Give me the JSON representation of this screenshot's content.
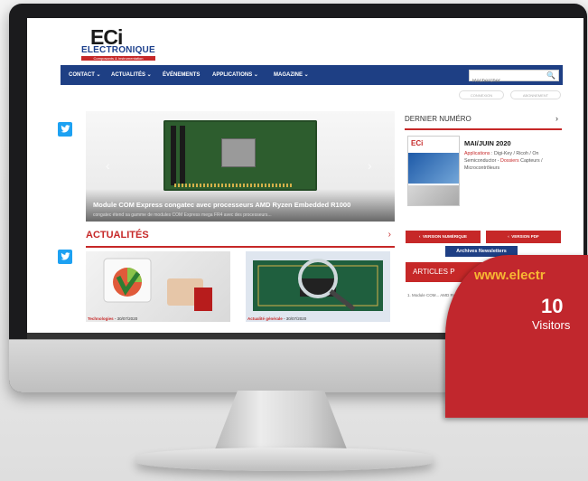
{
  "site": {
    "logo_main": "ECi",
    "logo_sub": "ELECTRONIQUE",
    "logo_tagline": "Composants & Instrumentation"
  },
  "nav": {
    "items": [
      "CONTACT ⌄",
      "ACTUALITÉS ⌄",
      "ÉVÉNEMENTS",
      "APPLICATIONS ⌄",
      "MAGAZINE ⌄"
    ],
    "search_placeholder": "Rechercher",
    "connexion": "CONNEXION",
    "abonnement": "ABONNEMENT"
  },
  "hero": {
    "title": "Module COM Express congatec avec processeurs AMD Ryzen Embedded R1000",
    "subtitle": "congatec étend sa gamme de modules COM Express mega FR4 avec des processeurs..."
  },
  "actualites": {
    "title": "ACTUALITÉS",
    "cards": [
      {
        "category": "Technologies",
        "date": "30/07/2020"
      },
      {
        "category": "Actualité générale",
        "date": "30/07/2020"
      }
    ]
  },
  "right_column": {
    "issue_header": "DERNIER NUMÉRO",
    "issue_title": "MAI/JUIN 2020",
    "issue_applications_label": "Applications",
    "issue_text_1": " : Digi-Key / Ricoh / On Semiconductor - ",
    "issue_dossiers_label": "Dossiers",
    "issue_text_2": " Capteurs / Microcontrôleurs",
    "btn_numerique": "VERSION NUMÉRIQUE",
    "btn_pdf": "VERSION PDF",
    "archives": "Archives Newsletters",
    "articles_header": "ARTICLES P",
    "article_item": "1. Module COM... AMD Ryzen E..."
  },
  "badge": {
    "url": "www.electr",
    "number": "10",
    "label": "Visitors"
  },
  "colors": {
    "navy": "#1e3f84",
    "red": "#c62828",
    "twitter": "#1da1f2",
    "badge_red": "#c1272d",
    "badge_gold": "#f7b733"
  }
}
